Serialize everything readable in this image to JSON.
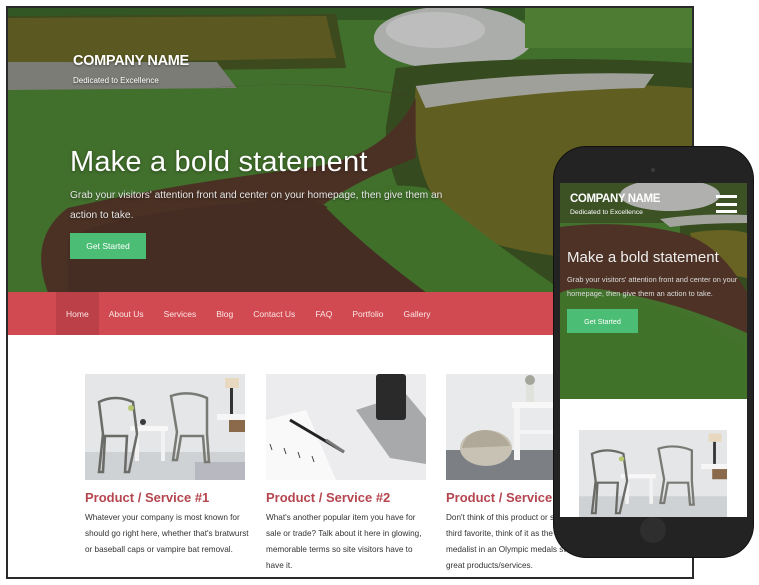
{
  "site": {
    "company_name": "COMPANY NAME",
    "tagline": "Dedicated to Excellence",
    "colors": {
      "nav_background": "#d14a51",
      "nav_active": "#bc4047",
      "cta_button": "#4cbd74",
      "product_heading": "#b5454f"
    }
  },
  "hero": {
    "headline": "Make a bold statement",
    "subline": "Grab your visitors' attention front and center on your homepage, then give them an action to take.",
    "cta_label": "Get Started",
    "background_image": "garden-flowerbed-photo"
  },
  "nav": {
    "items": [
      {
        "label": "Home",
        "active": true
      },
      {
        "label": "About Us",
        "active": false
      },
      {
        "label": "Services",
        "active": false
      },
      {
        "label": "Blog",
        "active": false
      },
      {
        "label": "Contact Us",
        "active": false
      },
      {
        "label": "FAQ",
        "active": false
      },
      {
        "label": "Portfolio",
        "active": false
      },
      {
        "label": "Gallery",
        "active": false
      }
    ]
  },
  "products": [
    {
      "title": "Product / Service #1",
      "description": "Whatever your company is most known for should go right here, whether that's bratwurst or baseball caps or vampire bat removal.",
      "image": "chairs-and-table-photo"
    },
    {
      "title": "Product / Service #2",
      "description": "What's another popular item you have for sale or trade? Talk about it here in glowing, memorable terms so site visitors have to have it.",
      "image": "tablet-phone-pen-photo"
    },
    {
      "title": "Product / Service #3",
      "description": "Don't think of this product or service as your third favorite, think of it as the bronze medalist in an Olympic medals sweep of great products/services.",
      "image": "pouf-and-console-photo"
    }
  ],
  "mobile": {
    "company_name": "COMPANY NAME",
    "tagline": "Dedicated to Excellence",
    "menu_icon": "hamburger-menu-icon",
    "headline": "Make a bold statement",
    "subline": "Grab your visitors' attention front and center on your homepage, then give them an action to take.",
    "cta_label": "Get Started",
    "product_image": "chairs-and-table-photo"
  }
}
